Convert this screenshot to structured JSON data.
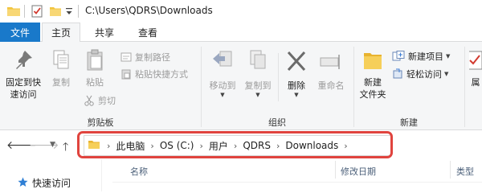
{
  "titlebar": {
    "path": "C:\\Users\\QDRS\\Downloads",
    "icons": [
      "folder-icon",
      "properties-check-icon",
      "new-folder-icon",
      "customize-dropdown-icon"
    ]
  },
  "tabs": {
    "file": "文件",
    "home": "主页",
    "share": "共享",
    "view": "查看"
  },
  "ribbon": {
    "clipboard": {
      "pin_line1": "固定到快",
      "pin_line2": "速访问",
      "copy": "复制",
      "paste": "粘贴",
      "copy_path": "复制路径",
      "paste_shortcut": "粘贴快捷方式",
      "cut": "剪切",
      "group_label": "剪贴板"
    },
    "organize": {
      "move_to": "移动到",
      "copy_to": "复制到",
      "delete": "删除",
      "rename": "重命名",
      "group_label": "组织"
    },
    "new": {
      "new_item": "新建项目",
      "easy_access": "轻松访问",
      "new_folder_line1": "新建",
      "new_folder_line2": "文件夹",
      "group_label": "新建"
    },
    "open": {
      "properties_partial": "属"
    }
  },
  "address": {
    "crumbs": [
      "此电脑",
      "OS (C:)",
      "用户",
      "QDRS",
      "Downloads"
    ],
    "highlight_color": "#e0443e"
  },
  "navpane": {
    "quick_access": "快速访问"
  },
  "columns": {
    "name": "名称",
    "modified": "修改日期",
    "type": "类型"
  },
  "colors": {
    "file_tab": "#1979ca",
    "ribbon_bg": "#f5f6f7",
    "folder": "#f5c040"
  }
}
